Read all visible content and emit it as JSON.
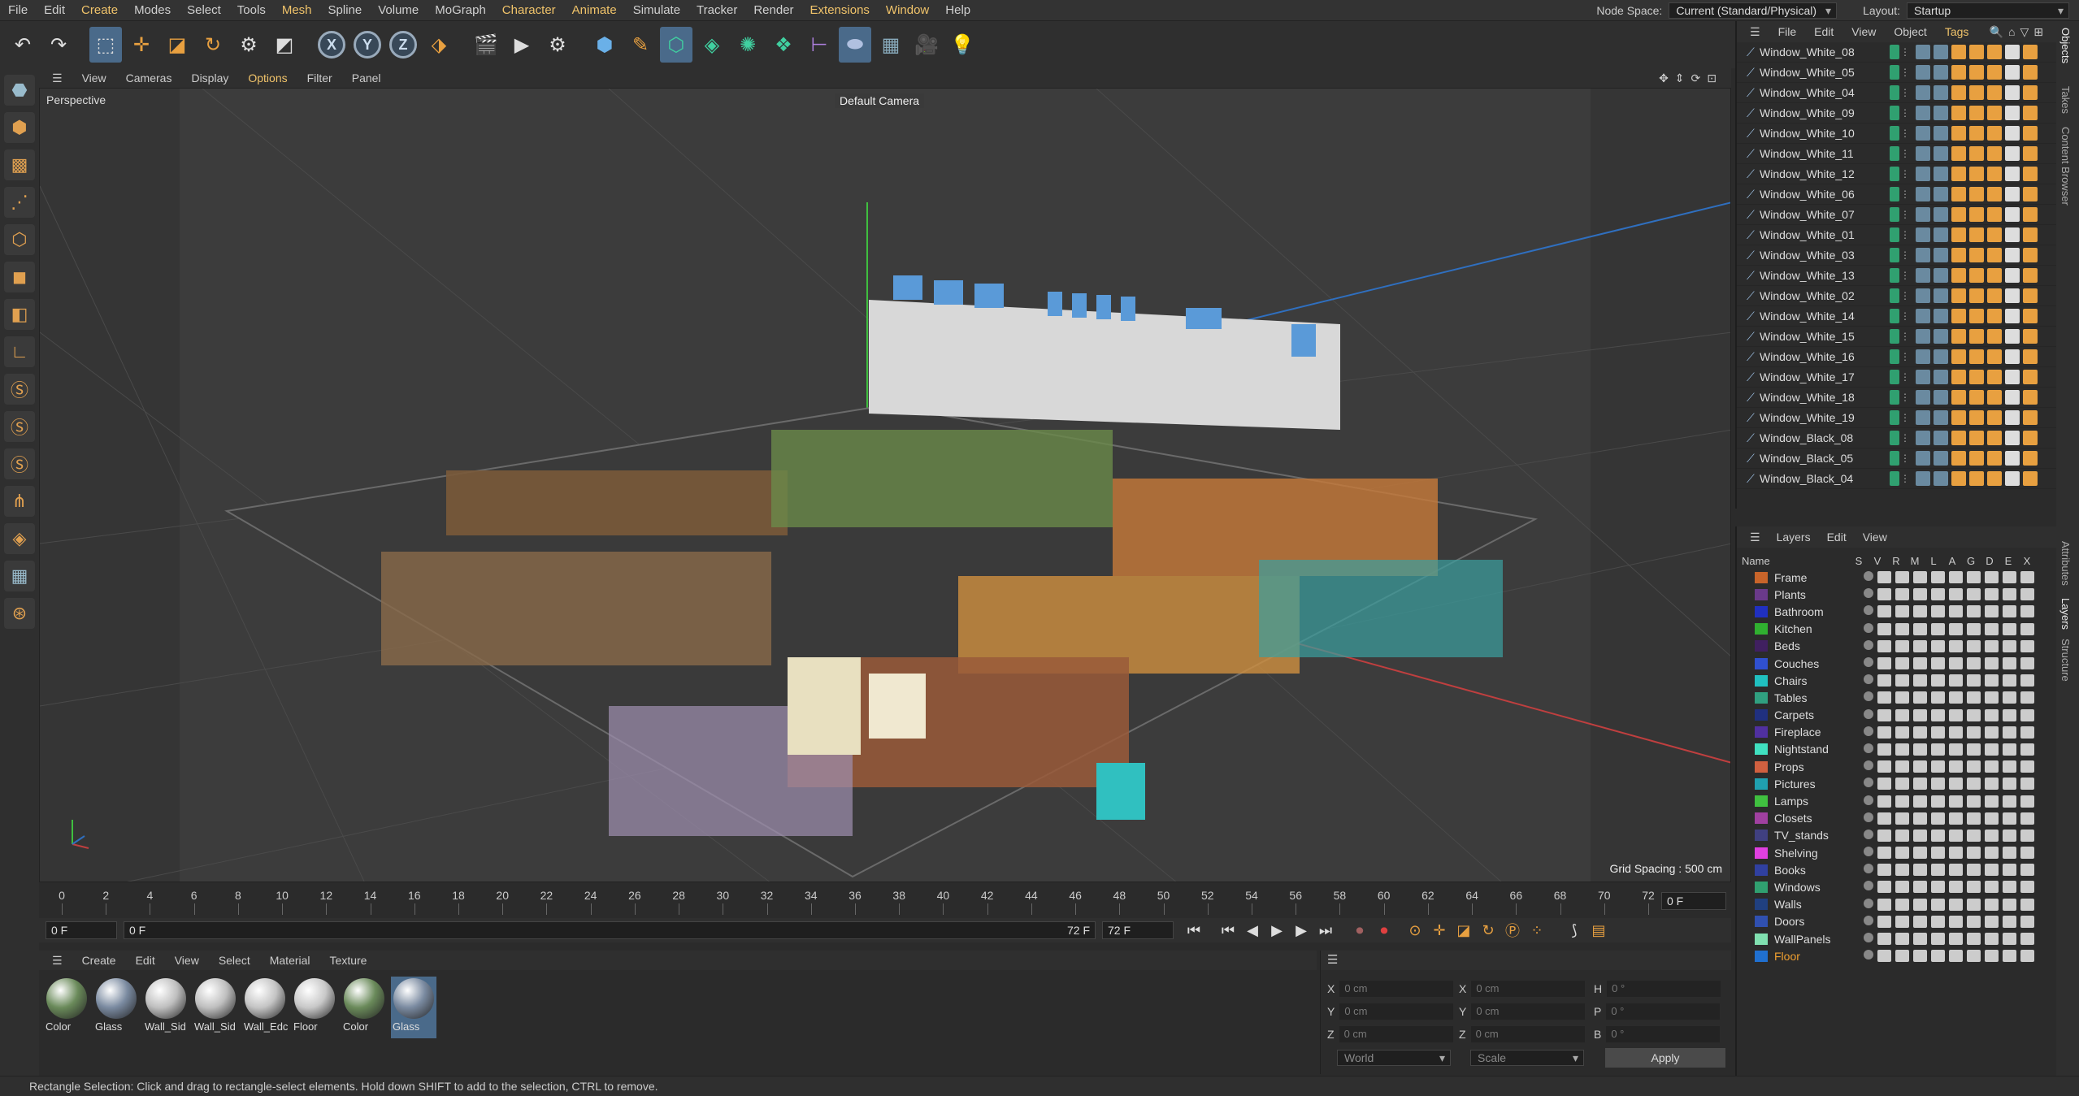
{
  "menubar": {
    "items": [
      {
        "label": "File"
      },
      {
        "label": "Edit"
      },
      {
        "label": "Create"
      },
      {
        "label": "Modes"
      },
      {
        "label": "Select"
      },
      {
        "label": "Tools"
      },
      {
        "label": "Mesh"
      },
      {
        "label": "Spline"
      },
      {
        "label": "Volume"
      },
      {
        "label": "MoGraph"
      },
      {
        "label": "Character"
      },
      {
        "label": "Animate"
      },
      {
        "label": "Simulate"
      },
      {
        "label": "Tracker"
      },
      {
        "label": "Render"
      },
      {
        "label": "Extensions"
      },
      {
        "label": "Window"
      },
      {
        "label": "Help"
      }
    ],
    "node_space_label": "Node Space:",
    "node_space_value": "Current (Standard/Physical)",
    "layout_label": "Layout:",
    "layout_value": "Startup"
  },
  "toolbar": {
    "undo_icon": "undo-icon",
    "x_label": "X",
    "y_label": "Y",
    "z_label": "Z"
  },
  "viewport": {
    "menu": [
      {
        "label": "View"
      },
      {
        "label": "Cameras"
      },
      {
        "label": "Display"
      },
      {
        "label": "Options"
      },
      {
        "label": "Filter"
      },
      {
        "label": "Panel"
      }
    ],
    "mode": "Perspective",
    "camera": "Default Camera",
    "grid_spacing": "Grid Spacing : 500 cm"
  },
  "timeline": {
    "ticks": [
      "0",
      "2",
      "4",
      "6",
      "8",
      "10",
      "12",
      "14",
      "16",
      "18",
      "20",
      "22",
      "24",
      "26",
      "28",
      "30",
      "32",
      "34",
      "36",
      "38",
      "40",
      "42",
      "44",
      "46",
      "48",
      "50",
      "52",
      "54",
      "56",
      "58",
      "60",
      "62",
      "64",
      "66",
      "68",
      "70",
      "72"
    ],
    "current_frame": "0 F",
    "start_field": "0 F",
    "range_start": "0 F",
    "range_end": "72 F",
    "end_field": "72 F"
  },
  "materials": {
    "menu": [
      {
        "label": "Create"
      },
      {
        "label": "Edit"
      },
      {
        "label": "View"
      },
      {
        "label": "Select"
      },
      {
        "label": "Material"
      },
      {
        "label": "Texture"
      }
    ],
    "items": [
      {
        "name": "Color",
        "color": "#6a8a5a"
      },
      {
        "name": "Glass",
        "color": "#7a8aa0"
      },
      {
        "name": "Wall_Sid",
        "color": "#bfbfbf"
      },
      {
        "name": "Wall_Sid",
        "color": "#bfbfbf"
      },
      {
        "name": "Wall_Edc",
        "color": "#c4c4c4"
      },
      {
        "name": "Floor",
        "color": "#c8c8c8"
      },
      {
        "name": "Color",
        "color": "#6a8a5a"
      },
      {
        "name": "Glass",
        "color": "#7a8aa0"
      }
    ]
  },
  "coords": {
    "x_label": "X",
    "y_label": "Y",
    "z_label": "Z",
    "h_label": "H",
    "p_label": "P",
    "b_label": "B",
    "pos_x": "0 cm",
    "pos_y": "0 cm",
    "pos_z": "0 cm",
    "size_x": "0 cm",
    "size_y": "0 cm",
    "size_z": "0 cm",
    "rot_h": "0 °",
    "rot_p": "0 °",
    "rot_b": "0 °",
    "space": "World",
    "mode": "Scale",
    "apply": "Apply"
  },
  "status": "Rectangle Selection: Click and drag to rectangle-select elements. Hold down SHIFT to add to the selection, CTRL to remove.",
  "objects": {
    "menu": [
      {
        "label": "File"
      },
      {
        "label": "Edit"
      },
      {
        "label": "View"
      },
      {
        "label": "Object"
      },
      {
        "label": "Tags"
      }
    ],
    "rows": [
      "Window_White_08",
      "Window_White_05",
      "Window_White_04",
      "Window_White_09",
      "Window_White_10",
      "Window_White_11",
      "Window_White_12",
      "Window_White_06",
      "Window_White_07",
      "Window_White_01",
      "Window_White_03",
      "Window_White_13",
      "Window_White_02",
      "Window_White_14",
      "Window_White_15",
      "Window_White_16",
      "Window_White_17",
      "Window_White_18",
      "Window_White_19",
      "Window_Black_08",
      "Window_Black_05",
      "Window_Black_04"
    ]
  },
  "layers": {
    "menu": [
      {
        "label": "Layers"
      },
      {
        "label": "Edit"
      },
      {
        "label": "View"
      }
    ],
    "header": {
      "name": "Name",
      "cols": [
        "S",
        "V",
        "R",
        "M",
        "L",
        "A",
        "G",
        "D",
        "E",
        "X"
      ]
    },
    "rows": [
      {
        "name": "Frame",
        "color": "#c8642a"
      },
      {
        "name": "Plants",
        "color": "#6a3a8a"
      },
      {
        "name": "Bathroom",
        "color": "#2030c0"
      },
      {
        "name": "Kitchen",
        "color": "#30b030"
      },
      {
        "name": "Beds",
        "color": "#402060"
      },
      {
        "name": "Couches",
        "color": "#3050d0"
      },
      {
        "name": "Chairs",
        "color": "#20c0c0"
      },
      {
        "name": "Tables",
        "color": "#30a080"
      },
      {
        "name": "Carpets",
        "color": "#203080"
      },
      {
        "name": "Fireplace",
        "color": "#5030a0"
      },
      {
        "name": "Nightstand",
        "color": "#40e0c0"
      },
      {
        "name": "Props",
        "color": "#d06040"
      },
      {
        "name": "Pictures",
        "color": "#20a0b0"
      },
      {
        "name": "Lamps",
        "color": "#40c040"
      },
      {
        "name": "Closets",
        "color": "#a040a0"
      },
      {
        "name": "TV_stands",
        "color": "#404080"
      },
      {
        "name": "Shelving",
        "color": "#e040e0"
      },
      {
        "name": "Books",
        "color": "#3040a0"
      },
      {
        "name": "Windows",
        "color": "#30a070"
      },
      {
        "name": "Walls",
        "color": "#204080"
      },
      {
        "name": "Doors",
        "color": "#3050b0"
      },
      {
        "name": "WallPanels",
        "color": "#80e0b0"
      },
      {
        "name": "Floor",
        "color": "#2070d0"
      }
    ]
  },
  "vtabs": [
    "Objects",
    "Takes",
    "Content Browser",
    "Attributes",
    "Layers",
    "Structure"
  ]
}
